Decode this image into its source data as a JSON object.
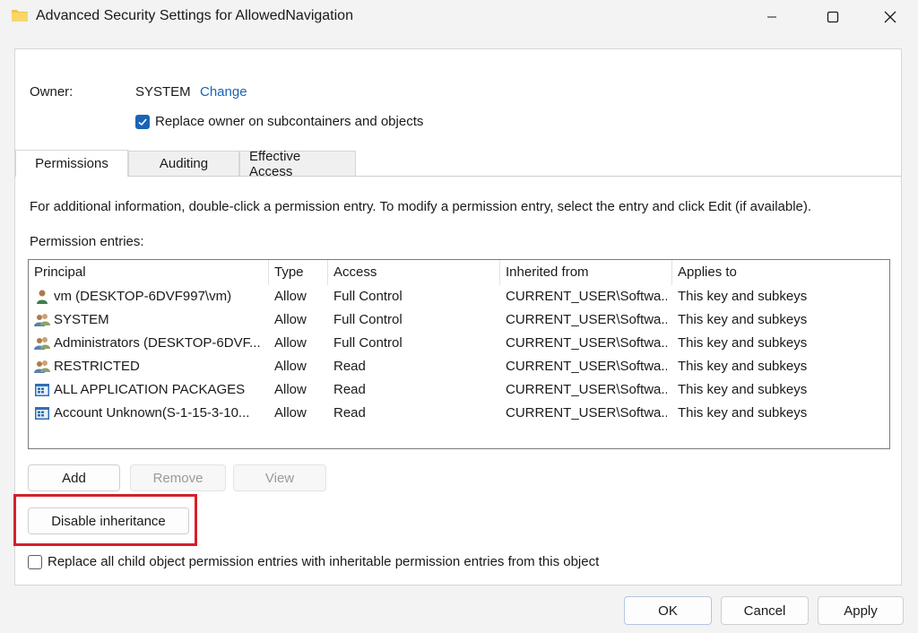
{
  "window": {
    "title": "Advanced Security Settings for AllowedNavigation",
    "icon": "folder-icon"
  },
  "owner": {
    "label": "Owner:",
    "value": "SYSTEM",
    "change_link": "Change",
    "replace_checkbox_label": "Replace owner on subcontainers and objects",
    "replace_checked": true
  },
  "tabs": [
    {
      "label": "Permissions",
      "active": true
    },
    {
      "label": "Auditing",
      "active": false
    },
    {
      "label": "Effective Access",
      "active": false
    }
  ],
  "permissions": {
    "info_text": "For additional information, double-click a permission entry. To modify a permission entry, select the entry and click Edit (if available).",
    "entries_label": "Permission entries:",
    "columns": [
      "Principal",
      "Type",
      "Access",
      "Inherited from",
      "Applies to"
    ],
    "rows": [
      {
        "icon": "user-icon",
        "principal": "vm (DESKTOP-6DVF997\\vm)",
        "type": "Allow",
        "access": "Full Control",
        "inherited": "CURRENT_USER\\Softwa...",
        "applies": "This key and subkeys"
      },
      {
        "icon": "group-icon",
        "principal": "SYSTEM",
        "type": "Allow",
        "access": "Full Control",
        "inherited": "CURRENT_USER\\Softwa...",
        "applies": "This key and subkeys"
      },
      {
        "icon": "group-icon",
        "principal": "Administrators (DESKTOP-6DVF...",
        "type": "Allow",
        "access": "Full Control",
        "inherited": "CURRENT_USER\\Softwa...",
        "applies": "This key and subkeys"
      },
      {
        "icon": "group-icon",
        "principal": "RESTRICTED",
        "type": "Allow",
        "access": "Read",
        "inherited": "CURRENT_USER\\Softwa...",
        "applies": "This key and subkeys"
      },
      {
        "icon": "app-package-icon",
        "principal": "ALL APPLICATION PACKAGES",
        "type": "Allow",
        "access": "Read",
        "inherited": "CURRENT_USER\\Softwa...",
        "applies": "This key and subkeys"
      },
      {
        "icon": "app-package-icon",
        "principal": "Account Unknown(S-1-15-3-10...",
        "type": "Allow",
        "access": "Read",
        "inherited": "CURRENT_USER\\Softwa...",
        "applies": "This key and subkeys"
      }
    ]
  },
  "buttons": {
    "add": "Add",
    "remove": "Remove",
    "view": "View",
    "disable_inheritance": "Disable inheritance",
    "ok": "OK",
    "cancel": "Cancel",
    "apply": "Apply"
  },
  "replace_child": {
    "label": "Replace all child object permission entries with inheritable permission entries from this object",
    "checked": false
  },
  "colors": {
    "accent": "#1a64b8",
    "highlight": "#d4202a"
  }
}
